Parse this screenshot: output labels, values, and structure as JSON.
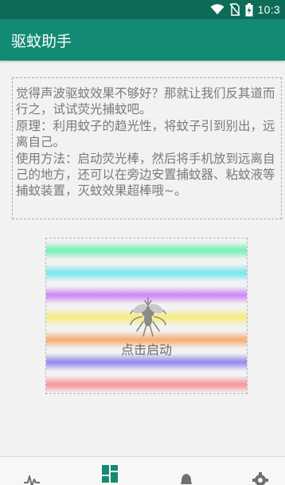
{
  "status_bar": {
    "time": "10:3",
    "icons": [
      "wifi-icon",
      "no-sim-icon",
      "battery-charging-icon"
    ]
  },
  "toolbar": {
    "title": "驱蚊助手"
  },
  "description": {
    "lines": [
      "觉得声波驱蚊效果不够好？那就让我们反其道而行之，试试荧光捕蚊吧。",
      "原理：利用蚊子的趋光性，将蚊子引到别出，远离自己。",
      "使用方法：启动荧光棒，然后将手机放到远离自己的地方，还可以在旁边安置捕蚊器、粘蚊液等捕蚊装置，灭蚊效果超棒哦~。"
    ]
  },
  "start_panel": {
    "label": "点击启动",
    "icon": "mosquito-icon",
    "stripe_colors": [
      "#7ff0b8",
      "#7fe8f0",
      "#cf8ef5",
      "#f5ee86",
      "#f7b27a",
      "#9a8ff0",
      "#f59ca0"
    ]
  },
  "bottom_nav": {
    "items": [
      {
        "icon": "waveform-icon",
        "selected": false
      },
      {
        "icon": "grid-icon",
        "selected": true
      },
      {
        "icon": "bell-icon",
        "selected": false
      },
      {
        "icon": "gear-icon",
        "selected": false
      }
    ],
    "accent_color": "#138a73",
    "inactive_color": "#6f6f6f"
  }
}
